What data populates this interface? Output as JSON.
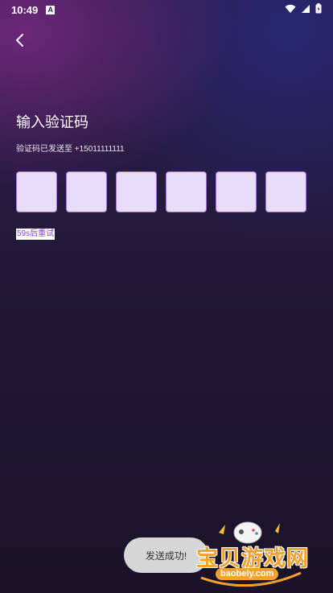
{
  "status_bar": {
    "time": "10:49",
    "notification_icon_glyph": "A",
    "icons": [
      "wifi-icon",
      "signal-icon",
      "battery-icon"
    ]
  },
  "header": {
    "back_icon": "chevron-left-icon"
  },
  "main": {
    "title": "输入验证码",
    "subtitle": "验证码已发送至 +15011111111",
    "code_box_count": 6,
    "resend_label": "59s后重试"
  },
  "toast": {
    "message": "发送成功!"
  },
  "watermark": {
    "text": "宝贝游戏网",
    "url": "baobeiy.com"
  },
  "colors": {
    "box_fill": "#e9dcf8",
    "box_border": "#a974d6",
    "accent": "#8a3fd0",
    "watermark": "#f2a22b"
  }
}
